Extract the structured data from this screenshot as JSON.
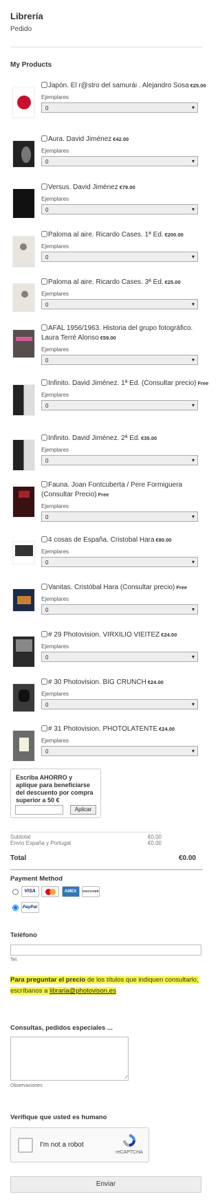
{
  "header": {
    "title": "Librería",
    "subtitle": "Pedido"
  },
  "products_section": {
    "title": "My Products"
  },
  "ejemplares_label": "Ejemplares",
  "products": [
    {
      "name": "Japón. El r@stro del samurái . Alejandro Sosa",
      "price": "€25.00",
      "qty": "0"
    },
    {
      "name": "Aura. David Jiménez",
      "price": "€42.00",
      "qty": "0"
    },
    {
      "name": "Versus. David Jiménez",
      "price": "€79.00",
      "qty": "0"
    },
    {
      "name": "Paloma al aire. Ricardo Cases. 1ª Ed.",
      "price": "€200.00",
      "qty": "0"
    },
    {
      "name": "Paloma al aire. Ricardo Cases. 3ª Ed.",
      "price": "€25.00",
      "qty": "0"
    },
    {
      "name": "AFAL 1956/1963. Historia del grupo fotográfico. Laura Terré Alonso",
      "price": "€59.00",
      "qty": "0"
    },
    {
      "name": "Infinito. David Jiménez. 1ª Ed. (Consultar precio)",
      "price": "Free",
      "qty": "0"
    },
    {
      "name": "Infinito. David Jiménez. 2ª Ed.",
      "price": "€35.00",
      "qty": "0"
    },
    {
      "name": "Fauna. Joan Fontcuberta / Pere Formiguera (Consultar Precio)",
      "price": "Free",
      "qty": "0"
    },
    {
      "name": "4 cosas de España. Cristobal Hara",
      "price": "€80.00",
      "qty": "0"
    },
    {
      "name": "Vanitas. Cristóbal Hara (Consultar precio)",
      "price": "Free",
      "qty": "0"
    },
    {
      "name": "# 29 Photovision. VIRXILIO VIEITEZ",
      "price": "€24.00",
      "qty": "0"
    },
    {
      "name": "# 30 Photovision. BIG CRUNCH",
      "price": "€24.00",
      "qty": "0"
    },
    {
      "name": "# 31 Photovision. PHOTOLATENTE",
      "price": "€24.00",
      "qty": "0"
    }
  ],
  "coupon": {
    "text": "Escriba AHORRO y aplique para beneficiarse del descuento por compra superior a 50 €",
    "input_value": "",
    "button": "Aplicar"
  },
  "totals": {
    "subtotal_label": "Subtotal",
    "subtotal_value": "€0.00",
    "shipping_label": "Envío España y Portugal",
    "shipping_value": "€0.00",
    "total_label": "Total",
    "total_value": "€0.00"
  },
  "payment": {
    "title": "Payment Method",
    "cards": [
      "VISA",
      "MC",
      "AMEX",
      "DISCOVER"
    ],
    "paypal": "PayPal",
    "selected": "paypal"
  },
  "phone": {
    "label": "Teléfono",
    "value": "",
    "sublabel": "Tel."
  },
  "note": {
    "bold": "Para preguntar el precio",
    "text": " de los títulos que indiquen consultarlo, escríbanos a ",
    "email": "libraria@photovison.es"
  },
  "comments": {
    "label": "Consultas, pedidos especiales ...",
    "value": "",
    "sublabel": "Observaciones"
  },
  "verify": {
    "label": "Verifique que usted es humano",
    "robot_text": "I'm not a robot",
    "brand": "reCAPTCHA"
  },
  "submit": {
    "label": "Enviar"
  },
  "colors": {
    "highlight": "#f5f53a",
    "visa": "#1a1f71",
    "amex": "#2e77bc",
    "paypal": "#003087"
  }
}
